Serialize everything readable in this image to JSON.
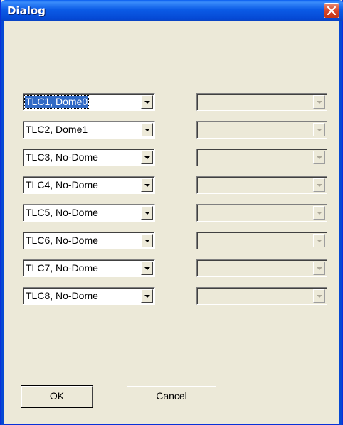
{
  "window": {
    "title": "Dialog"
  },
  "left_combos": [
    "TLC1, Dome0",
    "TLC2, Dome1",
    "TLC3, No-Dome",
    "TLC4, No-Dome",
    "TLC5, No-Dome",
    "TLC6, No-Dome",
    "TLC7, No-Dome",
    "TLC8, No-Dome"
  ],
  "right_combos": [
    "",
    "",
    "",
    "",
    "",
    "",
    "",
    ""
  ],
  "buttons": {
    "ok_label": "OK",
    "cancel_label": "Cancel"
  },
  "colors": {
    "title_bar": "#0548d4",
    "close_button": "#d6462a",
    "dialog_bg": "#ece9d8",
    "selection": "#316ac5"
  },
  "icons": {
    "close": "close-icon",
    "dropdown": "chevron-down-icon"
  }
}
